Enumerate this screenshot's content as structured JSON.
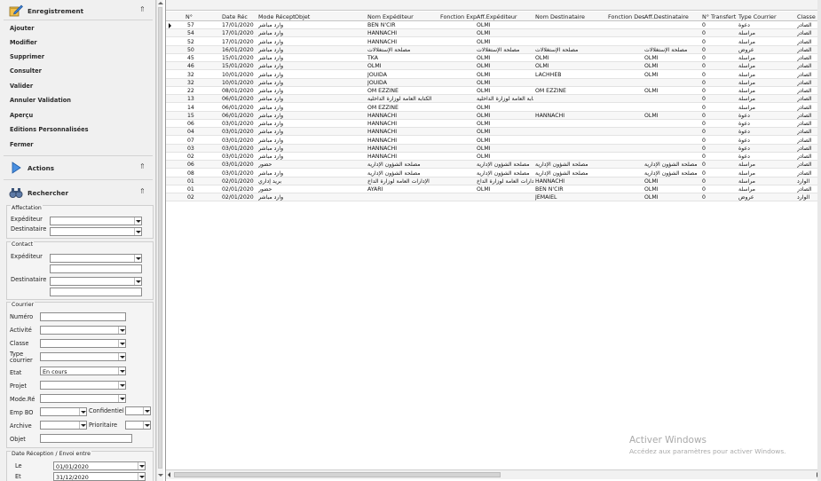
{
  "left_panel": {
    "enregistrement": {
      "title": "Enregistrement",
      "items": [
        "Ajouter",
        "Modifier",
        "Supprimer",
        "Consulter",
        "Valider",
        "Annuler Validation",
        "Aperçu",
        "Editions Personnalisées",
        "Fermer"
      ]
    },
    "actions": {
      "title": "Actions"
    },
    "rechercher": {
      "title": "Rechercher",
      "affectation": {
        "title": "Affectation",
        "expediteur": "Expéditeur",
        "destinataire": "Destinataire"
      },
      "contact": {
        "title": "Contact",
        "expediteur": "Expéditeur",
        "destinataire": "Destinataire"
      },
      "courrier": {
        "title": "Courrier",
        "numero": "Numéro",
        "activite": "Activité",
        "classe": "Classe",
        "type_courrier_1": "Type",
        "type_courrier_2": "courrier",
        "etat": "Etat",
        "etat_value": "En cours",
        "projet": "Projet",
        "mode_re": "Mode.Ré",
        "emp_bo": "Emp BO",
        "confidentiel": "Confidentiel",
        "archive": "Archive",
        "prioritaire": "Prioritaire",
        "objet": "Objet"
      },
      "date_group": {
        "title": "Date Réception / Envoi entre",
        "le": "Le",
        "le_value": "01/01/2020",
        "et": "Et",
        "et_value": "31/12/2020"
      }
    }
  },
  "grid": {
    "columns": [
      "N°",
      "Date Réc",
      "Mode Récept",
      "Objet",
      "Nom Expéditeur",
      "Fonction Exp",
      "Aff.Expéditeur",
      "Nom Destinataire",
      "Fonction Des",
      "Aff.Destinataire",
      "N° Transfert",
      "Type Courrier",
      "Classe"
    ],
    "rows": [
      {
        "n": "57",
        "date": "17/01/2020",
        "mode": "وارد مباشر",
        "exp": "BEN N'CIR",
        "affexp": "OLMI",
        "dest": "",
        "affdest": "",
        "transfert": "0",
        "type": "دعوة",
        "classe": "الصادر"
      },
      {
        "n": "54",
        "date": "17/01/2020",
        "mode": "وارد مباشر",
        "exp": "HANNACHI",
        "affexp": "OLMI",
        "dest": "",
        "affdest": "",
        "transfert": "0",
        "type": "مراسلة",
        "classe": "الصادر"
      },
      {
        "n": "52",
        "date": "17/01/2020",
        "mode": "وارد مباشر",
        "exp": "HANNACHI",
        "affexp": "OLMI",
        "dest": "",
        "affdest": "",
        "transfert": "0",
        "type": "مراسلة",
        "classe": "الصادر"
      },
      {
        "n": "50",
        "date": "16/01/2020",
        "mode": "وارد مباشر",
        "exp": "مصلحة الإستغلالات",
        "affexp": "مصلحة الإستغلالات",
        "dest": "مصلحة الإستغلالات",
        "affdest": "مصلحة الإستغلالات",
        "transfert": "0",
        "type": "عروض",
        "classe": "الصادر"
      },
      {
        "n": "45",
        "date": "15/01/2020",
        "mode": "وارد مباشر",
        "exp": "TKA",
        "affexp": "OLMI",
        "dest": "OLMI",
        "affdest": "OLMI",
        "transfert": "0",
        "type": "مراسلة",
        "classe": "الصادر"
      },
      {
        "n": "46",
        "date": "15/01/2020",
        "mode": "وارد مباشر",
        "exp": "OLMI",
        "affexp": "OLMI",
        "dest": "OLMI",
        "affdest": "OLMI",
        "transfert": "0",
        "type": "مراسلة",
        "classe": "الصادر"
      },
      {
        "n": "32",
        "date": "10/01/2020",
        "mode": "وارد مباشر",
        "exp": "JOUIDA",
        "affexp": "OLMI",
        "dest": "LACHHEB",
        "affdest": "OLMI",
        "transfert": "0",
        "type": "مراسلة",
        "classe": "الصادر"
      },
      {
        "n": "32",
        "date": "10/01/2020",
        "mode": "وارد مباشر",
        "exp": "JOUIDA",
        "affexp": "OLMI",
        "dest": "",
        "affdest": "",
        "transfert": "0",
        "type": "مراسلة",
        "classe": "الصادر"
      },
      {
        "n": "22",
        "date": "08/01/2020",
        "mode": "وارد مباشر",
        "exp": "OM EZZINE",
        "affexp": "OLMI",
        "dest": "OM EZZINE",
        "affdest": "OLMI",
        "transfert": "0",
        "type": "مراسلة",
        "classe": "الصادر"
      },
      {
        "n": "13",
        "date": "06/01/2020",
        "mode": "وارد مباشر",
        "exp": "الكتابة العامة لوزارة الداخلية",
        "affexp": "الكتابة العامة لوزارة الداخلية",
        "dest": "",
        "affdest": "",
        "transfert": "0",
        "type": "مراسلة",
        "classe": "الصادر"
      },
      {
        "n": "14",
        "date": "06/01/2020",
        "mode": "وارد مباشر",
        "exp": "OM EZZINE",
        "affexp": "OLMI",
        "dest": "",
        "affdest": "",
        "transfert": "0",
        "type": "مراسلة",
        "classe": "الصادر"
      },
      {
        "n": "15",
        "date": "06/01/2020",
        "mode": "وارد مباشر",
        "exp": "HANNACHI",
        "affexp": "OLMI",
        "dest": "HANNACHI",
        "affdest": "OLMI",
        "transfert": "0",
        "type": "دعوة",
        "classe": "الصادر"
      },
      {
        "n": "06",
        "date": "03/01/2020",
        "mode": "وارد مباشر",
        "exp": "HANNACHI",
        "affexp": "OLMI",
        "dest": "",
        "affdest": "",
        "transfert": "0",
        "type": "دعوة",
        "classe": "الصادر"
      },
      {
        "n": "04",
        "date": "03/01/2020",
        "mode": "وارد مباشر",
        "exp": "HANNACHI",
        "affexp": "OLMI",
        "dest": "",
        "affdest": "",
        "transfert": "0",
        "type": "دعوة",
        "classe": "الصادر"
      },
      {
        "n": "07",
        "date": "03/01/2020",
        "mode": "وارد مباشر",
        "exp": "HANNACHI",
        "affexp": "OLMI",
        "dest": "",
        "affdest": "",
        "transfert": "0",
        "type": "دعوة",
        "classe": "الصادر"
      },
      {
        "n": "03",
        "date": "03/01/2020",
        "mode": "وارد مباشر",
        "exp": "HANNACHI",
        "affexp": "OLMI",
        "dest": "",
        "affdest": "",
        "transfert": "0",
        "type": "دعوة",
        "classe": "الصادر"
      },
      {
        "n": "02",
        "date": "03/01/2020",
        "mode": "وارد مباشر",
        "exp": "HANNACHI",
        "affexp": "OLMI",
        "dest": "",
        "affdest": "",
        "transfert": "0",
        "type": "دعوة",
        "classe": "الصادر"
      },
      {
        "n": "06",
        "date": "03/01/2020",
        "mode": "حضور",
        "exp": "مصلحة الشؤون الإدارية",
        "affexp": "مصلحة الشؤون الإدارية",
        "dest": "مصلحة الشؤون الإدارية",
        "affdest": "مصلحة الشؤون الإدارية",
        "transfert": "0",
        "type": "مراسلة",
        "classe": "الصادر"
      },
      {
        "n": "08",
        "date": "03/01/2020",
        "mode": "وارد مباشر",
        "exp": "مصلحة الشؤون الإدارية",
        "affexp": "مصلحة الشؤون الإدارية",
        "dest": "مصلحة الشؤون الإدارية",
        "affdest": "مصلحة الشؤون الإدارية",
        "transfert": "0",
        "type": "مراسلة",
        "classe": "الصادر"
      },
      {
        "n": "01",
        "date": "02/01/2020",
        "mode": "بريد إداري",
        "exp": "الإدارات العامة لوزارة الداخ",
        "affexp": "الإدارات العامة لوزارة الداخ",
        "dest": "HANNACHI",
        "affdest": "OLMI",
        "transfert": "0",
        "type": "مراسلة",
        "classe": "الوارد"
      },
      {
        "n": "01",
        "date": "02/01/2020",
        "mode": "حضور",
        "exp": "AYARI",
        "affexp": "OLMI",
        "dest": "BEN N'CIR",
        "affdest": "OLMI",
        "transfert": "0",
        "type": "مراسلة",
        "classe": "الصادر"
      },
      {
        "n": "02",
        "date": "02/01/2020",
        "mode": "وارد مباشر",
        "exp": "",
        "affexp": "",
        "dest": "JEMAIEL",
        "affdest": "OLMI",
        "transfert": "0",
        "type": "عروض",
        "classe": "الوارد"
      }
    ]
  },
  "watermark": {
    "line1": "Activer Windows",
    "line2": "Accédez aux paramètres pour activer Windows."
  }
}
